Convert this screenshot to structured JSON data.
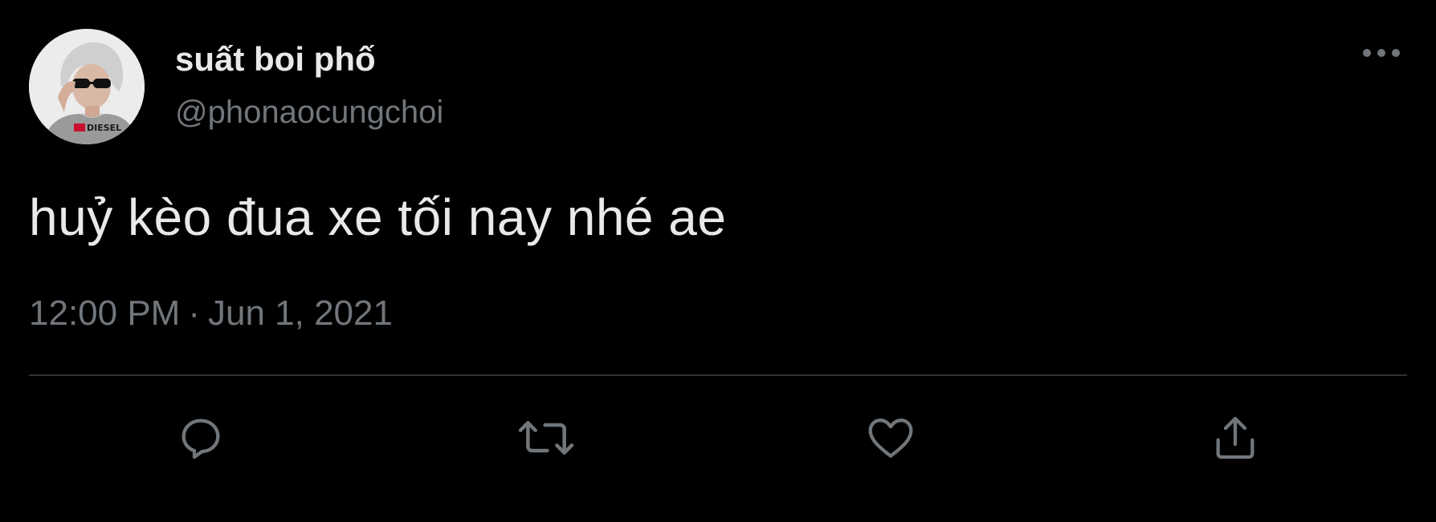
{
  "tweet": {
    "author": {
      "display_name": "suất boi phố",
      "handle": "@phonaocungchoi",
      "avatar_icon": "profile-photo"
    },
    "text": "huỷ kèo đua xe tối nay nhé ae",
    "time": "12:00 PM",
    "separator": "·",
    "date": "Jun 1, 2021",
    "more_icon": "more-horizontal-icon"
  },
  "actions": [
    {
      "name": "reply",
      "icon": "reply-icon"
    },
    {
      "name": "retweet",
      "icon": "retweet-icon"
    },
    {
      "name": "like",
      "icon": "heart-icon"
    },
    {
      "name": "share",
      "icon": "share-icon"
    }
  ],
  "colors": {
    "background": "#000000",
    "primary_text": "#e7e9ea",
    "secondary_text": "#71767b",
    "divider": "#2f3336"
  }
}
